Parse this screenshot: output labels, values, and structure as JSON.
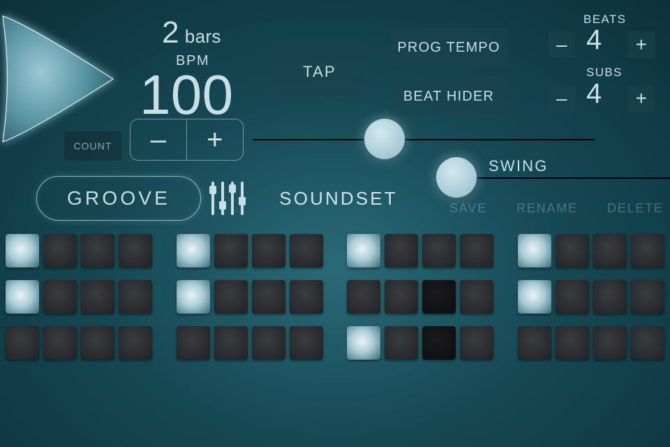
{
  "bars": {
    "value": "2",
    "label": "bars"
  },
  "bpm": {
    "label": "BPM",
    "value": "100"
  },
  "count": {
    "label": "COUNT"
  },
  "tap": {
    "label": "TAP"
  },
  "prog_tempo": {
    "label": "PROG TEMPO"
  },
  "beat_hider": {
    "label": "BEAT HIDER"
  },
  "beats": {
    "label": "BEATS",
    "value": "4"
  },
  "subs": {
    "label": "SUBS",
    "value": "4"
  },
  "swing": {
    "label": "SWING"
  },
  "groove": {
    "label": "GROOVE"
  },
  "soundset": {
    "label": "SOUNDSET"
  },
  "save": {
    "label": "SAVE"
  },
  "rename": {
    "label": "RENAME"
  },
  "delete": {
    "label": "DELETE"
  },
  "minus": "–",
  "plus": "+",
  "grid": {
    "rows": [
      [
        [
          "on",
          "",
          "",
          ""
        ],
        [
          "on",
          "",
          "",
          ""
        ],
        [
          "on",
          "",
          "",
          ""
        ],
        [
          "on",
          "",
          "",
          ""
        ]
      ],
      [
        [
          "on",
          "",
          "",
          ""
        ],
        [
          "on",
          "",
          "",
          ""
        ],
        [
          "",
          "",
          "dark",
          ""
        ],
        [
          "on",
          "",
          "",
          ""
        ]
      ],
      [
        [
          "",
          "",
          "",
          ""
        ],
        [
          "",
          "",
          "",
          ""
        ],
        [
          "on",
          "",
          "dark",
          ""
        ],
        [
          "",
          "",
          "",
          ""
        ]
      ]
    ]
  }
}
